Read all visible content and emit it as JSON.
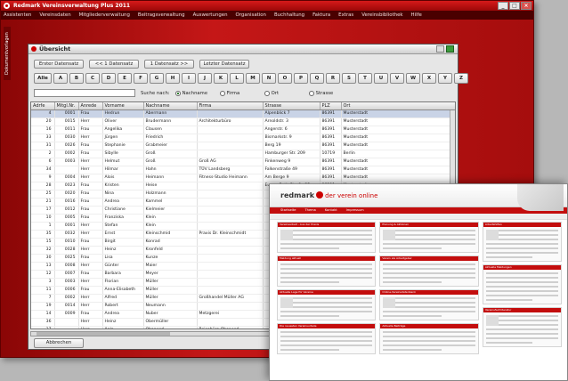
{
  "app": {
    "title": "Redmark Vereinsverwaltung Plus 2011",
    "menu": [
      "Assistenten",
      "Vereinsdaten",
      "Mitgliederverwaltung",
      "Beitragsverwaltung",
      "Auswertungen",
      "Organisation",
      "Buchhaltung",
      "Faktura",
      "Extras",
      "Vereinsbibliothek",
      "Hilfe"
    ],
    "side_tab": "Dokumentvorlagen"
  },
  "dialog": {
    "title": "Übersicht",
    "nav": [
      "Erster Datensatz",
      "<< 1 Datensatz",
      "1 Datensatz >>",
      "Letzter Datensatz"
    ],
    "letters": [
      "Alle",
      "A",
      "B",
      "C",
      "D",
      "E",
      "F",
      "G",
      "H",
      "I",
      "J",
      "K",
      "L",
      "M",
      "N",
      "O",
      "P",
      "Q",
      "R",
      "S",
      "T",
      "U",
      "V",
      "W",
      "X",
      "Y",
      "Z"
    ],
    "search_label": "Suche nach:",
    "radios": [
      "Nachname",
      "Firma",
      "Ort",
      "Strasse"
    ],
    "cancel_label": "Abbrechen"
  },
  "grid": {
    "columns": [
      "Adrfe",
      "Mitgl.Nr.",
      "Anrede",
      "Vorname",
      "Nachname",
      "Firma",
      "Strasse",
      "PLZ",
      "Ort"
    ],
    "rows": [
      [
        "4",
        "0001",
        "Frau",
        "Hedrun",
        "Abermann",
        "",
        "Alpenblick 7",
        "86391",
        "Musterstadt"
      ],
      [
        "20",
        "0015",
        "Herr",
        "Oliver",
        "Brudermann",
        "Architekturbüro",
        "Arnoldstr. 3",
        "86391",
        "Musterstadt"
      ],
      [
        "16",
        "0011",
        "Frau",
        "Angelika",
        "Clausen",
        "",
        "Angerstr. 6",
        "86391",
        "Musterstadt"
      ],
      [
        "33",
        "0030",
        "Herr",
        "Jürgen",
        "Friedrich",
        "",
        "Bismarkstr. 9",
        "86391",
        "Musterstadt"
      ],
      [
        "31",
        "0026",
        "Frau",
        "Stephanie",
        "Grabmeier",
        "",
        "Berg 19",
        "86391",
        "Musterstadt"
      ],
      [
        "2",
        "0002",
        "Frau",
        "Sibylle",
        "Groß",
        "",
        "Hamburger Str. 209",
        "10719",
        "Berlin"
      ],
      [
        "6",
        "0003",
        "Herr",
        "Helmut",
        "Groß",
        "Groß AG",
        "Finkenweg 9",
        "86391",
        "Musterstadt"
      ],
      [
        "34",
        "",
        "Herr",
        "Hilmar",
        "Hahn",
        "TÜV Landsberg",
        "Falkenstraße 49",
        "86391",
        "Musterstadt"
      ],
      [
        "9",
        "0004",
        "Herr",
        "Alois",
        "Heimann",
        "Fitness-Studio Heimann",
        "Am Berge 9",
        "86391",
        "Musterstadt"
      ],
      [
        "28",
        "0023",
        "Frau",
        "Kristen",
        "Heise",
        "",
        "Eugen-Roth-Straße 32",
        "86391",
        "Musterstadt"
      ],
      [
        "25",
        "0020",
        "Frau",
        "Nina",
        "Holzmann",
        "",
        "",
        "",
        ""
      ],
      [
        "21",
        "0016",
        "Frau",
        "Andrea",
        "Kammel",
        "",
        "",
        "",
        ""
      ],
      [
        "17",
        "0012",
        "Frau",
        "Christiane",
        "Kielmeier",
        "",
        "",
        "",
        ""
      ],
      [
        "10",
        "0005",
        "Frau",
        "Franziska",
        "Klein",
        "",
        "",
        "",
        ""
      ],
      [
        "1",
        "0001",
        "Herr",
        "Stefan",
        "Klein",
        "",
        "",
        "",
        ""
      ],
      [
        "35",
        "0032",
        "Herr",
        "Ernst",
        "Kleinschmid",
        "Praxis Dr. Kleinschmidt",
        "",
        "",
        ""
      ],
      [
        "15",
        "0010",
        "Frau",
        "Birgit",
        "Konrad",
        "",
        "",
        "",
        ""
      ],
      [
        "32",
        "0028",
        "Herr",
        "Heinz",
        "Kronfeld",
        "",
        "",
        "",
        ""
      ],
      [
        "30",
        "0025",
        "Frau",
        "Lisa",
        "Kunze",
        "",
        "",
        "",
        ""
      ],
      [
        "13",
        "0008",
        "Herr",
        "Günter",
        "Maier",
        "",
        "",
        "",
        ""
      ],
      [
        "12",
        "0007",
        "Frau",
        "Barbara",
        "Meyer",
        "",
        "",
        "",
        ""
      ],
      [
        "3",
        "0003",
        "Herr",
        "Florian",
        "Müller",
        "",
        "",
        "",
        ""
      ],
      [
        "11",
        "0006",
        "Frau",
        "Anna-Elisabeth",
        "Müller",
        "",
        "",
        "",
        ""
      ],
      [
        "7",
        "0002",
        "Herr",
        "Alfred",
        "Müller",
        "Großhandel Müller AG",
        "",
        "",
        ""
      ],
      [
        "19",
        "0014",
        "Herr",
        "Robert",
        "Neumann",
        "",
        "",
        "",
        ""
      ],
      [
        "14",
        "0009",
        "Frau",
        "Andrea",
        "Nuber",
        "Metzgerei",
        "",
        "",
        ""
      ],
      [
        "36",
        "",
        "Herr",
        "Heinz",
        "Obermüller",
        "",
        "",
        "",
        ""
      ],
      [
        "37",
        "",
        "Herr",
        "Anla",
        "Ohanesd",
        "Reisebüro Ohanesd",
        "",
        "",
        ""
      ]
    ]
  },
  "website": {
    "brand": "redmark",
    "tagline": "der verein online",
    "nav": [
      "Startseite",
      "Thema",
      "Kontakt",
      "Impressum"
    ],
    "panels_left": [
      "Vereinsarbeit - Aus der Praxis",
      "Meldung aktuell",
      "Aktuelle Lage für Vereine",
      "Die neuesten Vereinsurteile"
    ],
    "panels_mid": [
      "Planung & Aktionen",
      "Verein als Arbeitgeber",
      "Online-Vereinsdatenbank",
      "Aktuelle Beiträge"
    ],
    "panels_right": [
      "Arbeitshilfen",
      "Aktuelle Meldungen",
      "Vereinsfachliteratur"
    ]
  }
}
